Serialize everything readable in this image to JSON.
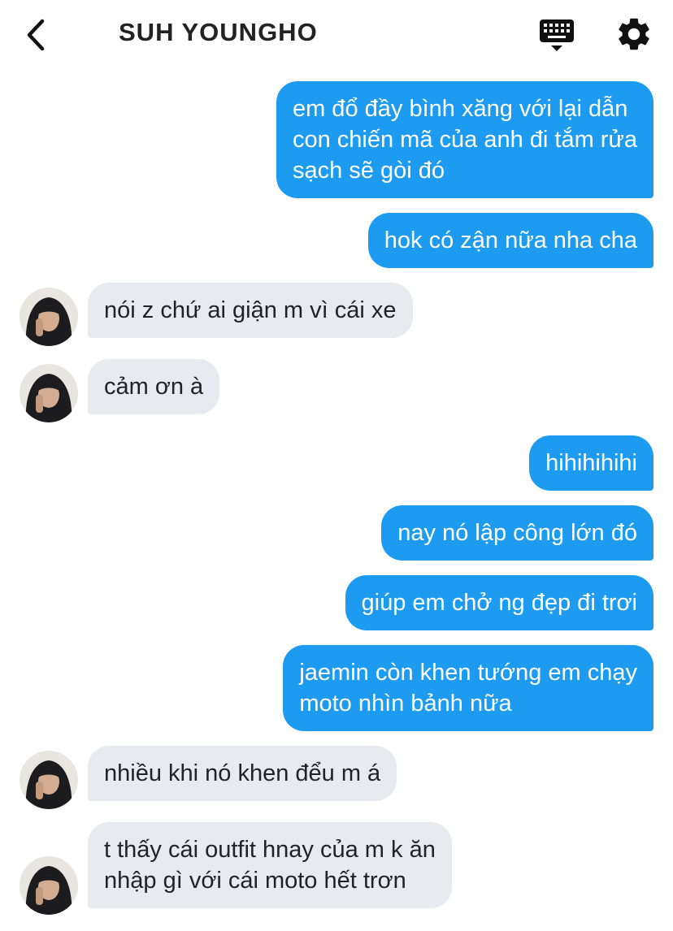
{
  "header": {
    "title": "SUH YOUNGHO",
    "back_icon": "chevron-left-icon",
    "keyboard_icon": "keyboard-icon",
    "settings_icon": "gear-icon"
  },
  "colors": {
    "outgoing_bubble": "#1d9bf0",
    "incoming_bubble": "#e7eaee"
  },
  "messages": [
    {
      "direction": "out",
      "text": "em đổ đầy bình xăng với lại dẫn\ncon chiến mã của anh đi tắm rửa\nsạch sẽ gòi đó"
    },
    {
      "direction": "out",
      "text": "hok có zận nữa nha cha"
    },
    {
      "direction": "in",
      "text": "nói z chứ ai giận m vì cái xe"
    },
    {
      "direction": "in",
      "text": "cảm ơn à"
    },
    {
      "direction": "out",
      "text": "hihihihihi"
    },
    {
      "direction": "out",
      "text": "nay nó lập công lớn đó"
    },
    {
      "direction": "out",
      "text": "giúp em chở ng đẹp đi trơi"
    },
    {
      "direction": "out",
      "text": "jaemin còn khen tướng em chạy\nmoto nhìn bảnh nữa"
    },
    {
      "direction": "in",
      "text": "nhiều khi nó khen đểu m á"
    },
    {
      "direction": "in",
      "text": "t thấy cái outfit hnay của m k ăn\nnhập gì với cái moto hết trơn"
    }
  ]
}
